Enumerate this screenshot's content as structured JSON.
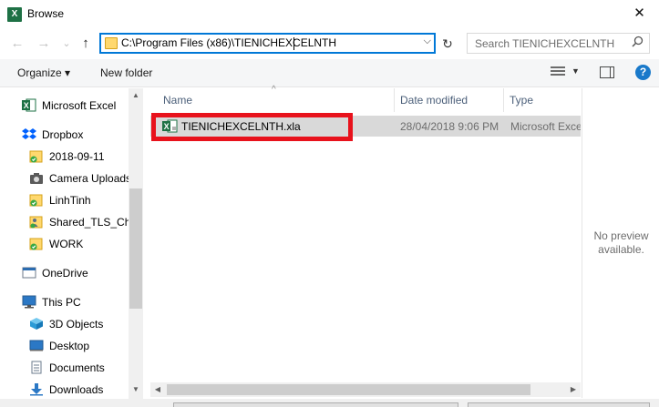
{
  "window": {
    "title": "Browse",
    "app_icon_letter": "X",
    "close_glyph": "✕"
  },
  "nav": {
    "back_glyph": "←",
    "forward_glyph": "→",
    "recent_glyph": "⌄",
    "up_glyph": "↑",
    "address_path": "C:\\Program Files (x86)\\TIENICHEXCELNTH",
    "address_dropdown_glyph": "⌵",
    "refresh_glyph": "↻",
    "search_placeholder": "Search TIENICHEXCELNTH",
    "search_glyph": "⌕"
  },
  "toolbar": {
    "organize_label": "Organize ▾",
    "new_folder_label": "New folder",
    "view_dropdown_glyph": "▼",
    "help_glyph": "?"
  },
  "sidebar": {
    "items": [
      {
        "label": "Microsoft Excel",
        "icon": "excel-icon"
      },
      {
        "label": "Dropbox",
        "icon": "dropbox-icon"
      },
      {
        "label": "2018-09-11",
        "icon": "folder-synced-icon"
      },
      {
        "label": "Camera Uploads",
        "icon": "camera-folder-icon"
      },
      {
        "label": "LinhTinh",
        "icon": "folder-synced-icon"
      },
      {
        "label": "Shared_TLS_Cha",
        "icon": "shared-folder-icon"
      },
      {
        "label": "WORK",
        "icon": "folder-synced-icon"
      },
      {
        "label": "OneDrive",
        "icon": "onedrive-icon"
      },
      {
        "label": "This PC",
        "icon": "pc-icon"
      },
      {
        "label": "3D Objects",
        "icon": "3d-objects-icon"
      },
      {
        "label": "Desktop",
        "icon": "desktop-icon"
      },
      {
        "label": "Documents",
        "icon": "documents-icon"
      },
      {
        "label": "Downloads",
        "icon": "downloads-icon"
      }
    ]
  },
  "files": {
    "columns": [
      "Name",
      "Date modified",
      "Type"
    ],
    "sort_glyph": "^",
    "rows": [
      {
        "name": "TIENICHEXCELNTH.xla",
        "date": "28/04/2018 9:06 PM",
        "type": "Microsoft Excel",
        "icon": "excel-addin-icon"
      }
    ]
  },
  "preview": {
    "line1": "No preview",
    "line2": "available."
  },
  "scroll": {
    "up_glyph": "▲",
    "down_glyph": "▼",
    "left_glyph": "◀",
    "right_glyph": "▶"
  },
  "colors": {
    "accent": "#0078d7",
    "highlight_box": "#e8121c",
    "excel_green": "#1e7145",
    "selected_row": "#d9d9d9",
    "folder_yellow": "#ffd86e"
  }
}
